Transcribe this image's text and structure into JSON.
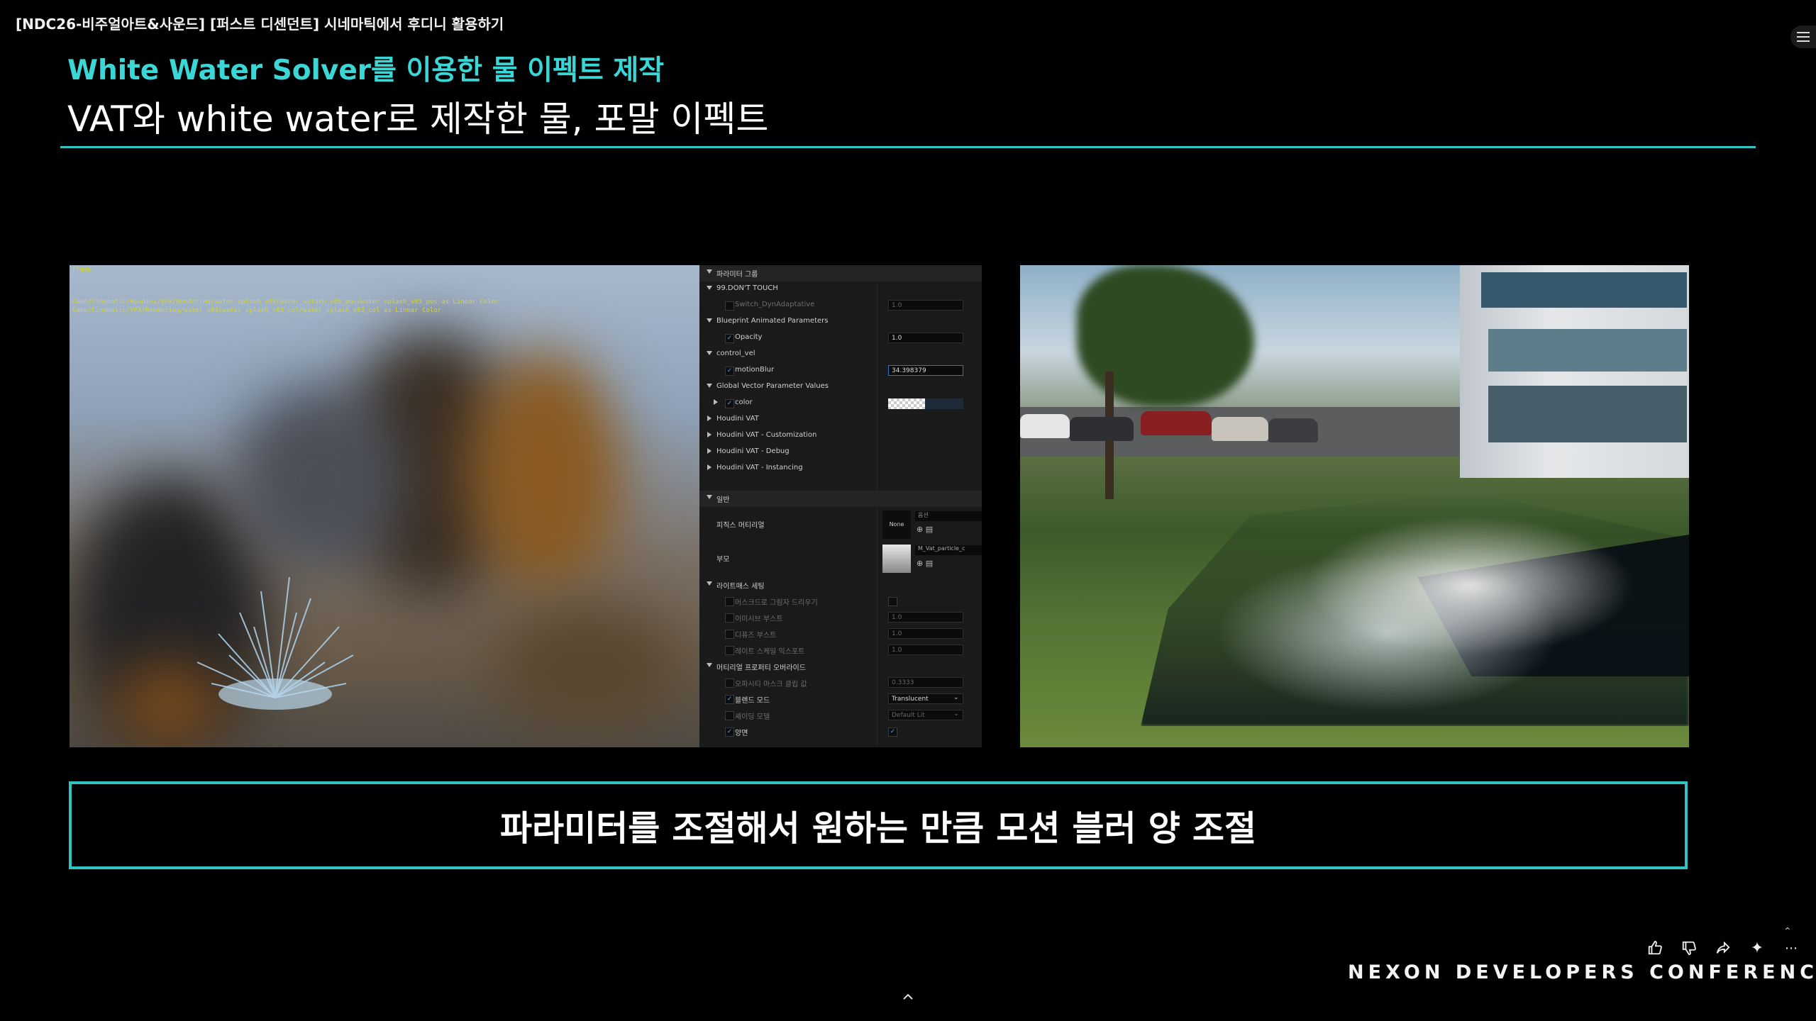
{
  "video": {
    "title": "[NDC26-비주얼아트&사운드] [퍼스트 디센던트] 시네마틱에서 후디니 활용하기"
  },
  "slide": {
    "title": "White Water Solver를 이용한 물 이펙트 제작",
    "subtitle": "VAT와 white water로 제작한 물, 포말 이펙트",
    "caption": "파라미터를 조절해서 원하는 만큼 모션 블러 양 조절",
    "accent_color": "#2ec4c4",
    "logo_text": "NEXON DEVELOPERS CONFERENCE"
  },
  "viewport": {
    "corner_text": "Frame",
    "debug_lines": [
      "Game/Cinematic/Houdini/VFX/Rendering/water_splash_v03/water_splash_v03_pos/water_splash_v03_pos as Linear Color",
      "Game/Cinematic/VFX/Rendering/water_v03/water_splash_v03_col/water_splash_v03_col as Linear Color"
    ]
  },
  "details_panel": {
    "rows": [
      {
        "type": "section",
        "label": "파라미터 그룹"
      },
      {
        "type": "group",
        "label": "99.DON'T TOUCH"
      },
      {
        "type": "param",
        "label": "Switch_DynAdaptative",
        "value": "1.0",
        "dim": true
      },
      {
        "type": "group",
        "label": "Blueprint Animated Parameters"
      },
      {
        "type": "param",
        "label": "Opacity",
        "value": "1.0",
        "checked": true
      },
      {
        "type": "group",
        "label": "control_vel"
      },
      {
        "type": "param",
        "label": "motionBlur",
        "value": "34.398379",
        "checked": true,
        "active": true
      },
      {
        "type": "group",
        "label": "Global Vector Parameter Values"
      },
      {
        "type": "param",
        "label": "color",
        "value": "",
        "checked": true,
        "swatch": true
      },
      {
        "type": "collapsed",
        "label": "Houdini VAT"
      },
      {
        "type": "collapsed",
        "label": "Houdini VAT - Customization"
      },
      {
        "type": "collapsed",
        "label": "Houdini VAT - Debug"
      },
      {
        "type": "collapsed",
        "label": "Houdini VAT - Instancing"
      }
    ],
    "general_section": "일반",
    "physical_material_label": "피직스 머티리얼",
    "physical_material_value": "None",
    "parent_label": "부모",
    "parent_value": "M_Vat_particle_c",
    "options_label": "옵션",
    "lightmass_section": "라이트매스 세팅",
    "lightmass_rows": [
      {
        "label": "머스크드로 그림자 드리우기",
        "value": ""
      },
      {
        "label": "이미시브 부스트",
        "value": "1.0"
      },
      {
        "label": "디퓨즈 부스트",
        "value": "1.0"
      },
      {
        "label": "레이트 스케일 익스포트",
        "value": "1.0"
      }
    ],
    "override_section": "머티리얼 프로퍼티 오버라이드",
    "override_rows": [
      {
        "label": "오파시티 마스크 클립 값",
        "value": "0.3333",
        "checked": false
      },
      {
        "label": "블렌드 모드",
        "value": "Translucent",
        "checked": true
      },
      {
        "label": "셰이딩 모델",
        "value": "Default Lit",
        "checked": false
      },
      {
        "label": "양면",
        "value": "",
        "checked": true
      }
    ]
  },
  "actions": {
    "like_icon": "thumbs-up-icon",
    "dislike_icon": "thumbs-down-icon",
    "share_icon": "share-icon",
    "sparkle_icon": "sparkle-icon",
    "more_icon": "more-icon"
  }
}
